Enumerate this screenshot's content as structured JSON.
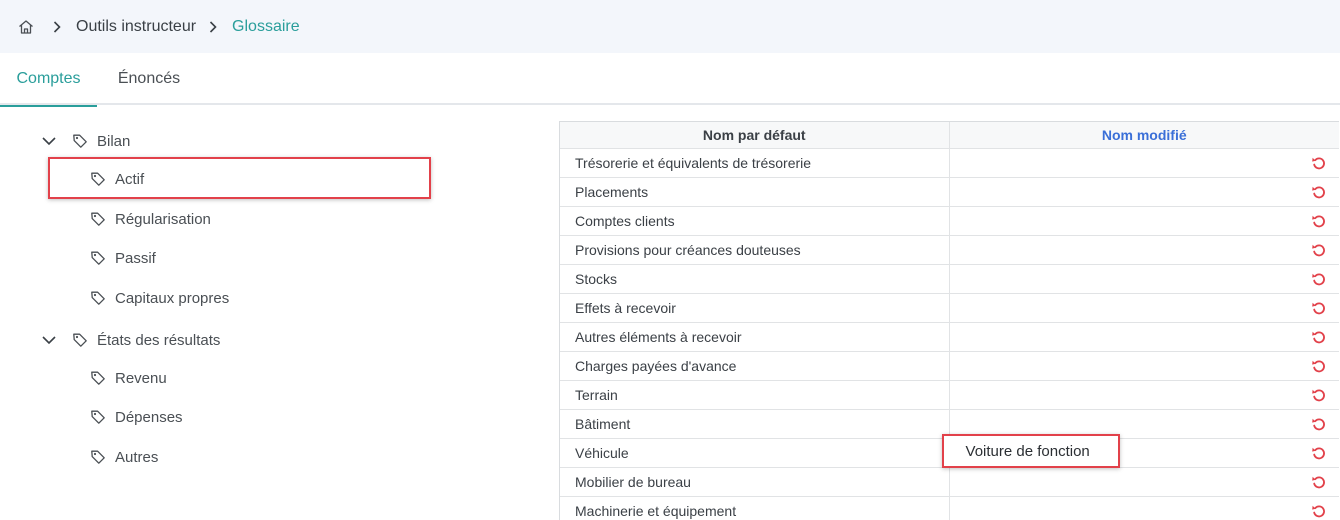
{
  "breadcrumb": {
    "items": [
      "Outils instructeur",
      "Glossaire"
    ]
  },
  "tabs": [
    "Comptes",
    "Énoncés"
  ],
  "tree": {
    "groups": [
      {
        "label": "Bilan",
        "children": [
          "Actif",
          "Régularisation",
          "Passif",
          "Capitaux propres"
        ]
      },
      {
        "label": "États des résultats",
        "children": [
          "Revenu",
          "Dépenses",
          "Autres"
        ]
      }
    ]
  },
  "table": {
    "headers": [
      "Nom par défaut",
      "Nom modifié"
    ],
    "rows": [
      {
        "default": "Trésorerie et équivalents de trésorerie",
        "modified": ""
      },
      {
        "default": "Placements",
        "modified": ""
      },
      {
        "default": "Comptes clients",
        "modified": ""
      },
      {
        "default": "Provisions pour créances douteuses",
        "modified": ""
      },
      {
        "default": "Stocks",
        "modified": ""
      },
      {
        "default": "Effets à recevoir",
        "modified": ""
      },
      {
        "default": "Autres éléments à recevoir",
        "modified": ""
      },
      {
        "default": "Charges payées d'avance",
        "modified": ""
      },
      {
        "default": "Terrain",
        "modified": ""
      },
      {
        "default": "Bâtiment",
        "modified": ""
      },
      {
        "default": "Véhicule",
        "modified": "Voiture de fonction"
      },
      {
        "default": "Mobilier de bureau",
        "modified": ""
      },
      {
        "default": "Machinerie et équipement",
        "modified": ""
      }
    ]
  },
  "colors": {
    "accent": "#2a9e9b",
    "link_blue": "#3a6fd8",
    "reset_red": "#e2414a"
  },
  "icons": {
    "home": "home-icon",
    "breadcrumb_sep": "chevron-right-icon",
    "tree_toggle": "chevron-down-icon",
    "tree_item": "tag-icon",
    "reset": "undo-icon"
  }
}
